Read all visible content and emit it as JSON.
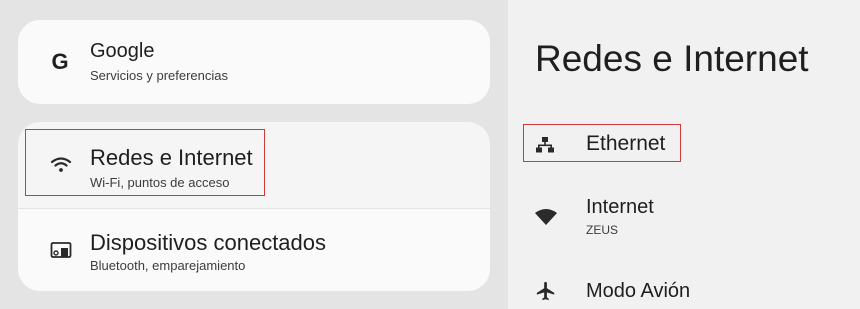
{
  "sidebar": {
    "items": [
      {
        "title": "Google",
        "subtitle": "Servicios y preferencias",
        "icon": "google-g-icon"
      },
      {
        "title": "Redes e Internet",
        "subtitle": "Wi-Fi, puntos de acceso",
        "icon": "wifi-icon"
      },
      {
        "title": "Dispositivos conectados",
        "subtitle": "Bluetooth, emparejamiento",
        "icon": "connected-devices-icon"
      }
    ]
  },
  "detail": {
    "title": "Redes e Internet",
    "items": [
      {
        "title": "Ethernet",
        "icon": "ethernet-icon"
      },
      {
        "title": "Internet",
        "subtitle": "ZEUS",
        "icon": "wifi-signal-icon"
      },
      {
        "title": "Modo Avión",
        "icon": "airplane-icon"
      }
    ]
  },
  "colors": {
    "highlight": "#d23a3a"
  },
  "google_icon_glyph": "G"
}
